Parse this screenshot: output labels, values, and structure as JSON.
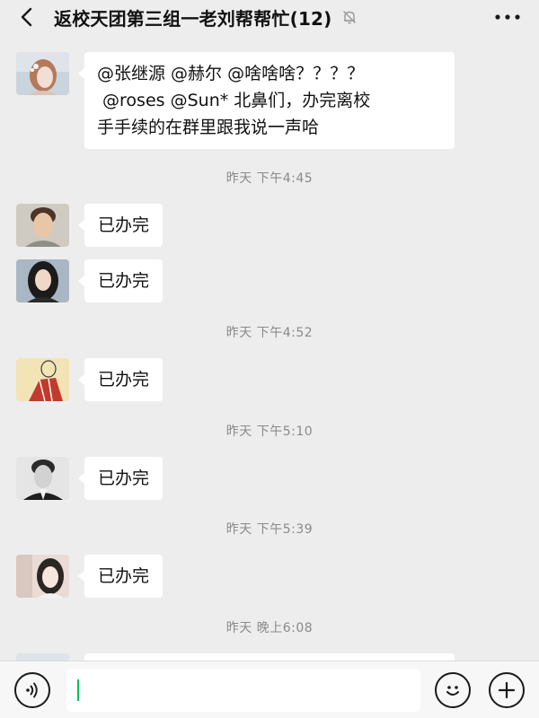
{
  "header": {
    "title": "返校天团第三组一老刘帮帮忙(12)",
    "back_icon": "chevron-left-icon",
    "mute_icon": "bell-off-icon",
    "more_icon": "more-dots-icon"
  },
  "messages": [
    {
      "type": "message",
      "avatar": "avatar-girl-flowers",
      "lines": [
        "@张继源 @赫尔 @啥啥啥？？？？",
        " @roses @Sun* 北鼻们，办完离校",
        "手手续的在群里跟我说一声哈"
      ]
    },
    {
      "type": "timestamp",
      "text": "昨天 下午4:45"
    },
    {
      "type": "message",
      "avatar": "avatar-young-man",
      "text": "已办完"
    },
    {
      "type": "message",
      "avatar": "avatar-girl-dark-hair",
      "text": "已办完"
    },
    {
      "type": "timestamp",
      "text": "昨天 下午4:52"
    },
    {
      "type": "message",
      "avatar": "avatar-sketch-figure",
      "text": "已办完"
    },
    {
      "type": "timestamp",
      "text": "昨天 下午5:10"
    },
    {
      "type": "message",
      "avatar": "avatar-man-bw",
      "text": "已办完"
    },
    {
      "type": "timestamp",
      "text": "昨天 下午5:39"
    },
    {
      "type": "message",
      "avatar": "avatar-girl-light",
      "text": "已办完"
    },
    {
      "type": "timestamp",
      "text": "昨天 晚上6:08"
    }
  ],
  "input_bar": {
    "voice_icon": "voice-icon",
    "input_value": "",
    "emoji_icon": "emoji-icon",
    "plus_icon": "plus-icon"
  },
  "colors": {
    "background": "#ededed",
    "bubble": "#ffffff",
    "caret": "#07c160",
    "timestamp": "#8a8a8a"
  }
}
